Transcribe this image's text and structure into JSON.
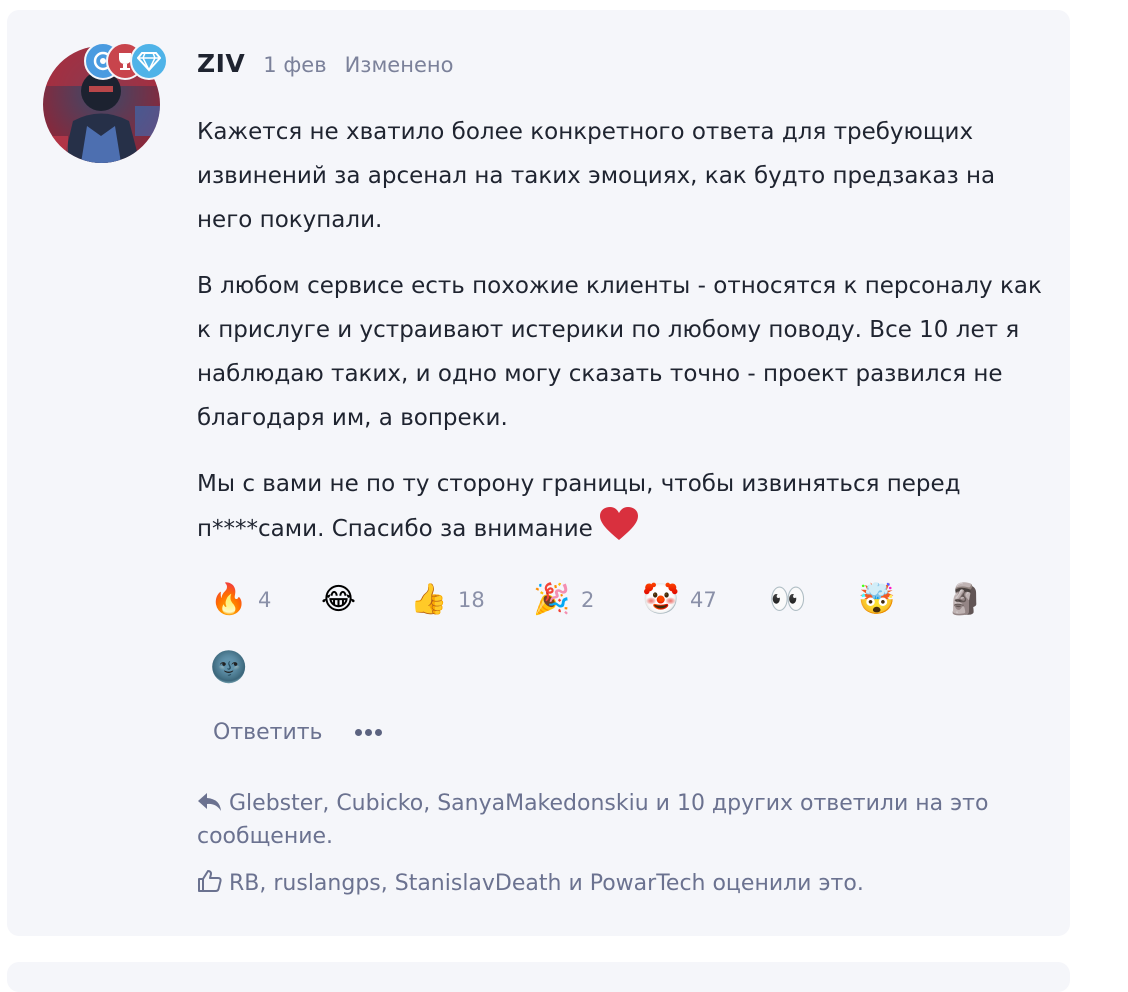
{
  "comment": {
    "author": "ZIV",
    "date": "1 фев",
    "edited": "Изменено",
    "paragraphs": [
      "Кажется не хватило более конкретного ответа для требующих извинений за арсенал на таких эмоциях, как будто предзаказ на него покупали.",
      "В любом сервисе есть похожие клиенты - относятся к персоналу как к прислуге и устраивают истерики по любому поводу. Все 10 лет я наблюдаю таких, и одно могу сказать точно - проект развился не благодаря им, а вопреки.",
      "Мы с вами не по ту сторону границы, чтобы извиняться перед п****сами. Спасибо за внимание"
    ],
    "badges": [
      {
        "icon": "gamepad-badge-icon",
        "color": "#4a9be0"
      },
      {
        "icon": "trophy-badge-icon",
        "color": "#c8444c"
      },
      {
        "icon": "diamond-badge-icon",
        "color": "#4fb3e8"
      }
    ]
  },
  "reactions": [
    {
      "emoji": "🔥",
      "icon": "fire-emoji",
      "count": "4"
    },
    {
      "emoji": "😂",
      "icon": "laughing-tears-emoji",
      "count": ""
    },
    {
      "emoji": "👍",
      "icon": "thumbs-up-emoji",
      "count": "18"
    },
    {
      "emoji": "🎉",
      "icon": "party-popper-emoji",
      "count": "2"
    },
    {
      "emoji": "🤡",
      "icon": "clown-emoji",
      "count": "47"
    },
    {
      "emoji": "👀",
      "icon": "eyes-emoji",
      "count": ""
    },
    {
      "emoji": "🤯",
      "icon": "exploding-head-emoji",
      "count": ""
    },
    {
      "emoji": "🗿",
      "icon": "moai-emoji",
      "count": ""
    },
    {
      "emoji": "🌚",
      "icon": "new-moon-face-emoji",
      "count": ""
    }
  ],
  "actions": {
    "reply_label": "Ответить"
  },
  "info": {
    "replies_text": "Glebster, Cubicko, SanyaMakedonskiu и 10 других ответили на это сообщение.",
    "likes_text": "RB, ruslangps, StanislavDeath и PowarTech оценили это."
  },
  "colors": {
    "card_background": "#f5f6fa",
    "text": "#1f2430",
    "muted": "#7b819a",
    "heart": "#d9303e"
  }
}
